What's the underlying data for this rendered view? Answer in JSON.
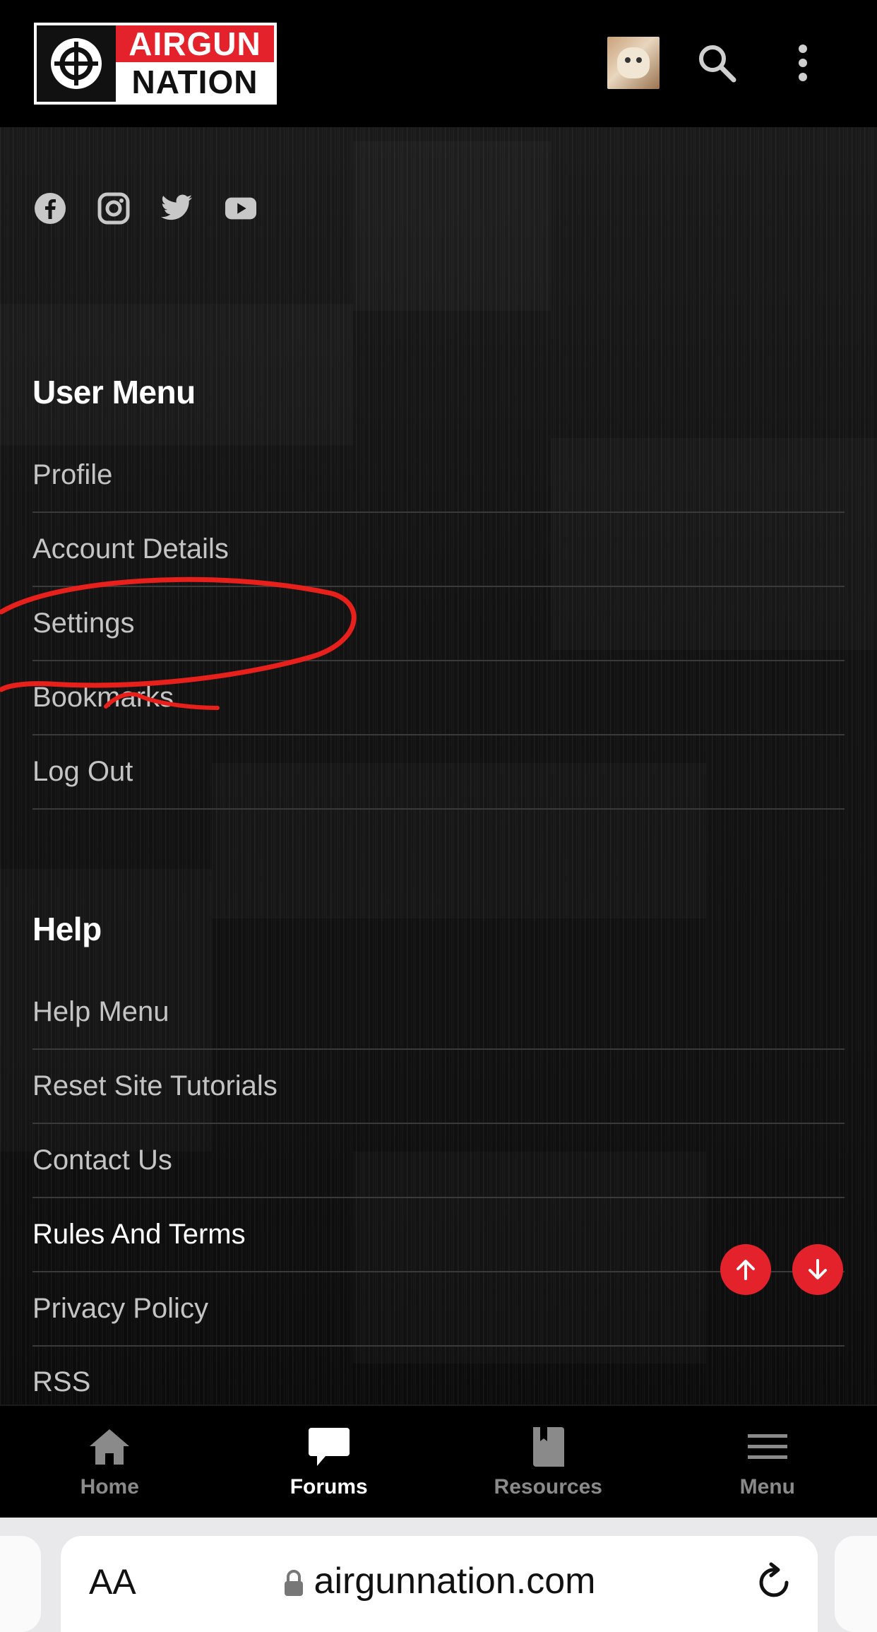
{
  "header": {
    "logo_line1": "AIRGUN",
    "logo_line2": "NATION",
    "avatar_icon": "bulldog-avatar",
    "search_icon": "search-icon",
    "more_icon": "vertical-dots-icon"
  },
  "social": [
    "facebook-icon",
    "instagram-icon",
    "twitter-icon",
    "youtube-icon"
  ],
  "user_menu": {
    "title": "User Menu",
    "items": [
      "Profile",
      "Account Details",
      "Settings",
      "Bookmarks",
      "Log Out"
    ]
  },
  "help_menu": {
    "title": "Help",
    "items": [
      "Help Menu",
      "Reset Site Tutorials",
      "Contact Us",
      "Rules And Terms",
      "Privacy Policy",
      "RSS"
    ]
  },
  "bottom_nav": {
    "items": [
      {
        "label": "Home",
        "icon": "home-icon"
      },
      {
        "label": "Forums",
        "icon": "chat-bubble-icon",
        "active": true
      },
      {
        "label": "Resources",
        "icon": "book-icon"
      },
      {
        "label": "Menu",
        "icon": "hamburger-icon"
      }
    ]
  },
  "browser": {
    "aa_label": "AA",
    "url": "airgunnation.com"
  },
  "colors": {
    "brand_red": "#e3222c",
    "annotation_red": "#e8201c"
  }
}
